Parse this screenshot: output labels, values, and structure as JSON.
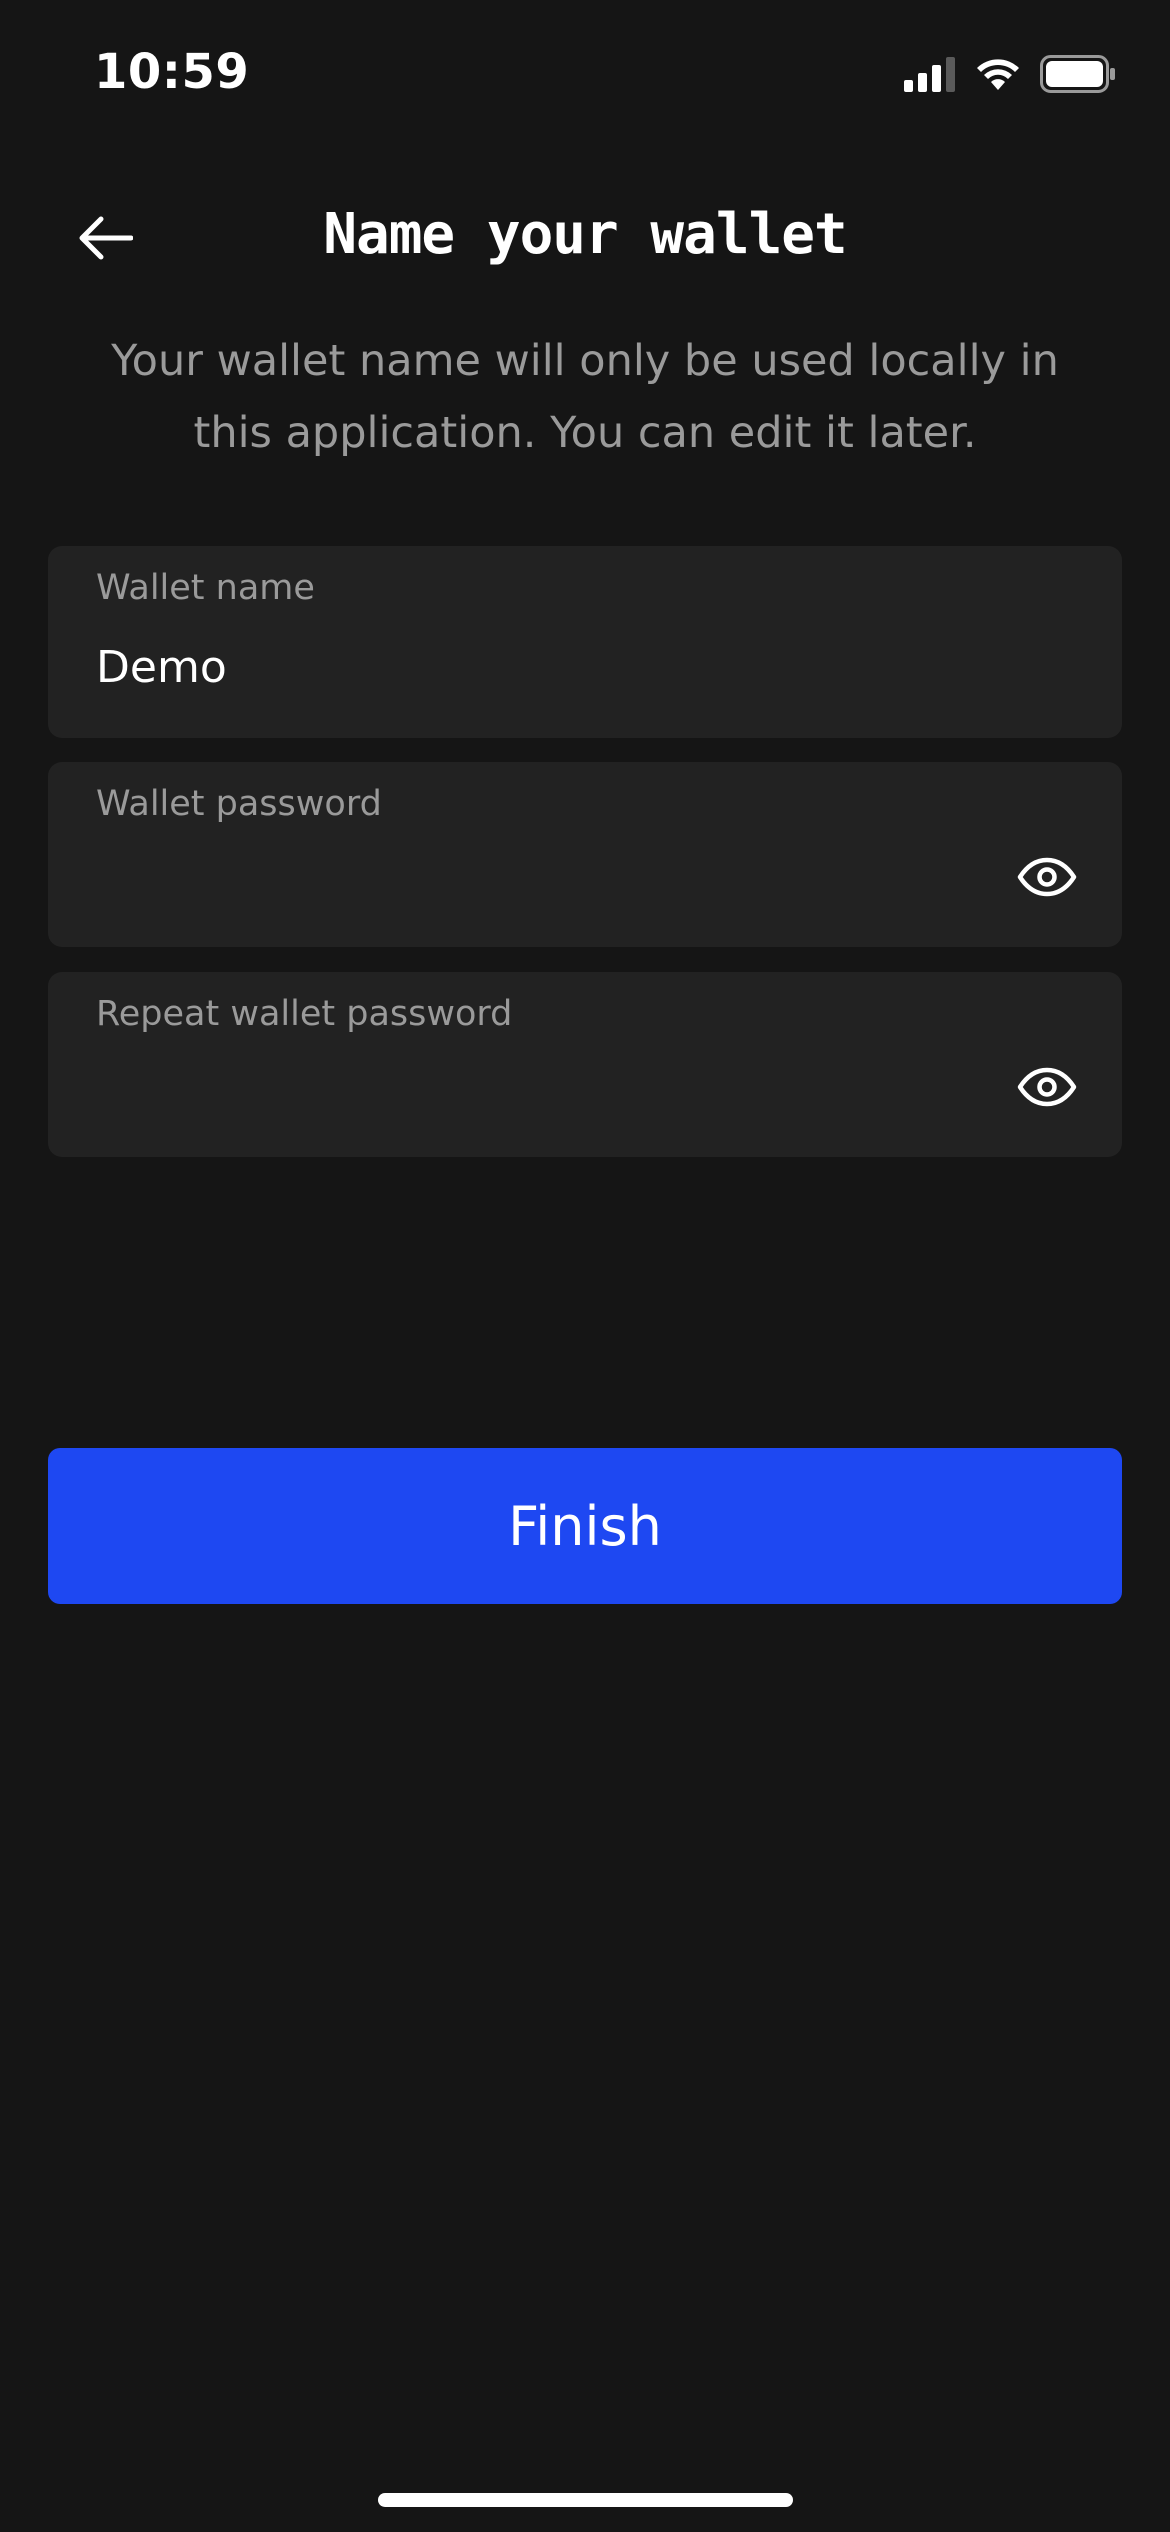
{
  "status_bar": {
    "time": "10:59",
    "icons": [
      "signal-icon",
      "wifi-icon",
      "battery-icon"
    ]
  },
  "header": {
    "title": "Name your wallet",
    "back_icon": "arrow-left-icon"
  },
  "subtitle": "Your wallet name will only be used locally in this application. You can edit it later.",
  "form": {
    "wallet_name": {
      "label": "Wallet name",
      "value": "Demo"
    },
    "wallet_password": {
      "label": "Wallet password",
      "value": "",
      "toggle_icon": "eye-icon"
    },
    "repeat_password": {
      "label": "Repeat wallet password",
      "value": "",
      "toggle_icon": "eye-icon"
    }
  },
  "finish_button": {
    "label": "Finish"
  },
  "colors": {
    "background": "#151515",
    "field_background": "#222222",
    "muted_text": "#9a9a9a",
    "accent": "#1e48f2"
  }
}
